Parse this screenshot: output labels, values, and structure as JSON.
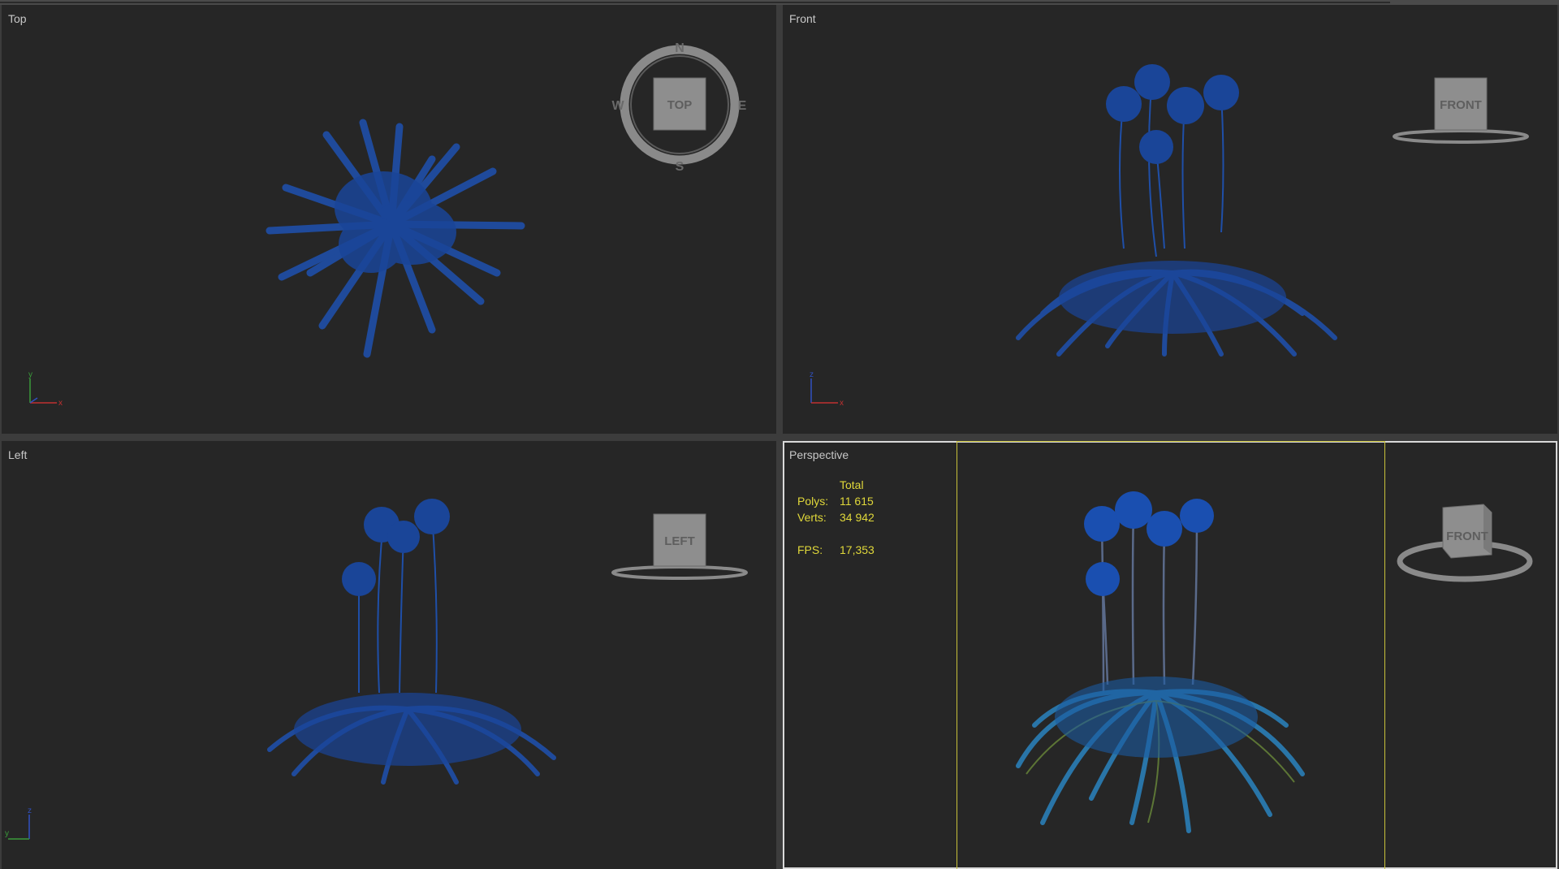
{
  "viewports": {
    "top": {
      "label": "Top",
      "cube_label": "TOP",
      "compass": [
        "N",
        "W",
        "E",
        "S"
      ],
      "axes": [
        "y",
        "x"
      ]
    },
    "front": {
      "label": "Front",
      "cube_label": "FRONT",
      "axes": [
        "z",
        "x"
      ]
    },
    "left": {
      "label": "Left",
      "cube_label": "LEFT",
      "axes": [
        "z",
        "y"
      ]
    },
    "perspective": {
      "label": "Perspective",
      "cube_label": "FRONT",
      "stats": {
        "header": "Total",
        "polys_label": "Polys:",
        "polys_value": "11 615",
        "verts_label": "Verts:",
        "verts_value": "34 942",
        "fps_label": "FPS:",
        "fps_value": "17,353"
      }
    }
  },
  "colors": {
    "wire": "#1f4fa8",
    "stats": "#e0d83a",
    "safe_frame": "#c9c23a",
    "viewport_bg": "#262626"
  }
}
